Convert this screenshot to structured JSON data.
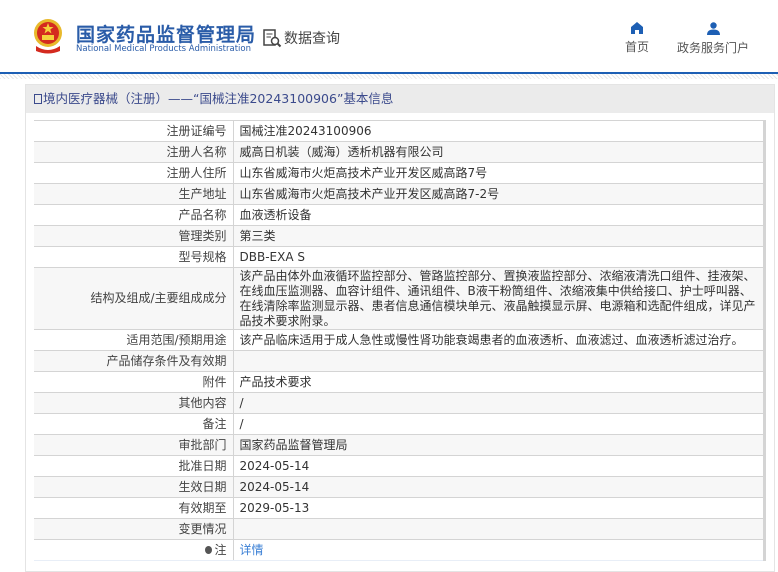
{
  "header": {
    "logo_cn": "国家药品监督管理局",
    "logo_en": "National Medical Products Administration",
    "data_query": "数据查询",
    "nav": [
      {
        "label": "首页",
        "icon": "home-icon"
      },
      {
        "label": "政务服务门户",
        "icon": "user-icon"
      }
    ]
  },
  "panel": {
    "title": "境内医疗器械（注册）——“国械注准20243100906”基本信息"
  },
  "rows": [
    {
      "label": "注册证编号",
      "value": "国械注准20243100906"
    },
    {
      "label": "注册人名称",
      "value": "威高日机装（威海）透析机器有限公司"
    },
    {
      "label": "注册人住所",
      "value": "山东省威海市火炬高技术产业开发区威高路7号"
    },
    {
      "label": "生产地址",
      "value": "山东省威海市火炬高技术产业开发区威高路7-2号"
    },
    {
      "label": "产品名称",
      "value": "血液透析设备"
    },
    {
      "label": "管理类别",
      "value": "第三类"
    },
    {
      "label": "型号规格",
      "value": "DBB-EXA S"
    },
    {
      "label": "结构及组成/主要组成成分",
      "value": "该产品由体外血液循环监控部分、管路监控部分、置换液监控部分、浓缩液清洗口组件、挂液架、在线血压监测器、血容计组件、通讯组件、B液干粉筒组件、浓缩液集中供给接口、护士呼叫器、在线清除率监测显示器、患者信息通信模块单元、液晶触摸显示屏、电源箱和选配件组成，详见产品技术要求附录。"
    },
    {
      "label": "适用范围/预期用途",
      "value": "该产品临床适用于成人急性或慢性肾功能衰竭患者的血液透析、血液滤过、血液透析滤过治疗。"
    },
    {
      "label": "产品储存条件及有效期",
      "value": ""
    },
    {
      "label": "附件",
      "value": "产品技术要求"
    },
    {
      "label": "其他内容",
      "value": "/"
    },
    {
      "label": "备注",
      "value": "/"
    },
    {
      "label": "审批部门",
      "value": "国家药品监督管理局"
    },
    {
      "label": "批准日期",
      "value": "2024-05-14"
    },
    {
      "label": "生效日期",
      "value": "2024-05-14"
    },
    {
      "label": "有效期至",
      "value": "2029-05-13"
    },
    {
      "label": "变更情况",
      "value": ""
    }
  ],
  "note": {
    "label": "注",
    "link": "详情"
  }
}
